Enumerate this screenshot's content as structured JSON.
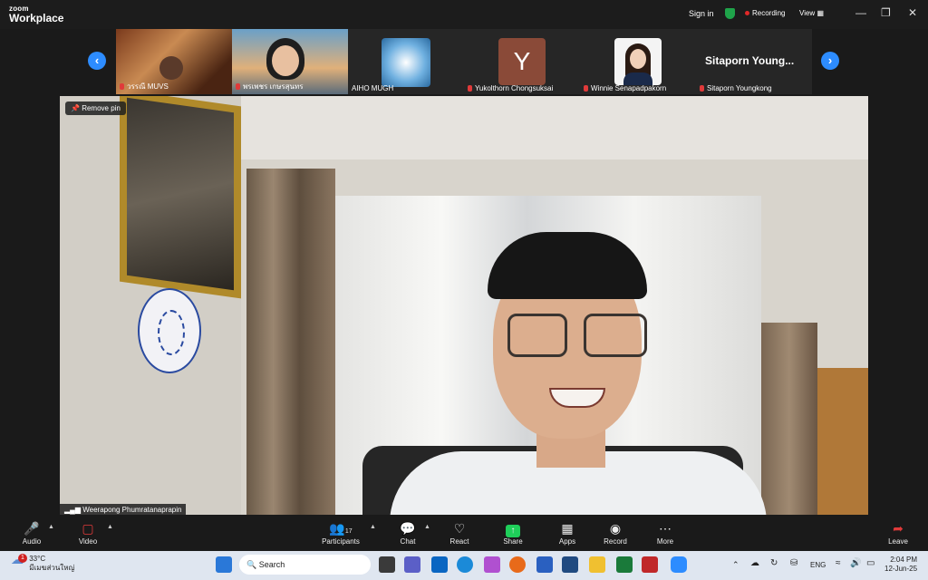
{
  "app": {
    "logo_small": "zoom",
    "logo_main": "Workplace"
  },
  "topbar": {
    "signin": "Sign in",
    "recording": "Recording",
    "view": "View"
  },
  "gallery": {
    "tiles": [
      {
        "name": "วรรณี MUVS"
      },
      {
        "name": "พรเพชร เกษรสุนทร"
      },
      {
        "name": "AIHO MUGH"
      },
      {
        "name": "Yukolthorn Chongsuksai",
        "initial": "Y"
      },
      {
        "name": "Winnie Senapadpakorn"
      },
      {
        "name": "Sitaporn Youngkong",
        "header": "Sitaporn Young..."
      }
    ]
  },
  "main": {
    "remove_pin": "Remove pin",
    "speaker": "Weerapong Phumratanaprapin"
  },
  "toolbar": {
    "audio": "Audio",
    "video": "Video",
    "participants": "Participants",
    "participants_count": "17",
    "chat": "Chat",
    "react": "React",
    "share": "Share",
    "apps": "Apps",
    "record": "Record",
    "more": "More",
    "leave": "Leave"
  },
  "taskbar": {
    "weather_temp": "33°C",
    "weather_desc": "มีเมฆส่วนใหญ่",
    "weather_badge": "1",
    "search": "Search",
    "lang": "ENG",
    "time": "2:04 PM",
    "date": "12-Jun-25"
  },
  "colors": {
    "accent": "#2d8cff",
    "share": "#1fcf5a",
    "recording": "#e02828",
    "muted": "#e03a3a"
  }
}
